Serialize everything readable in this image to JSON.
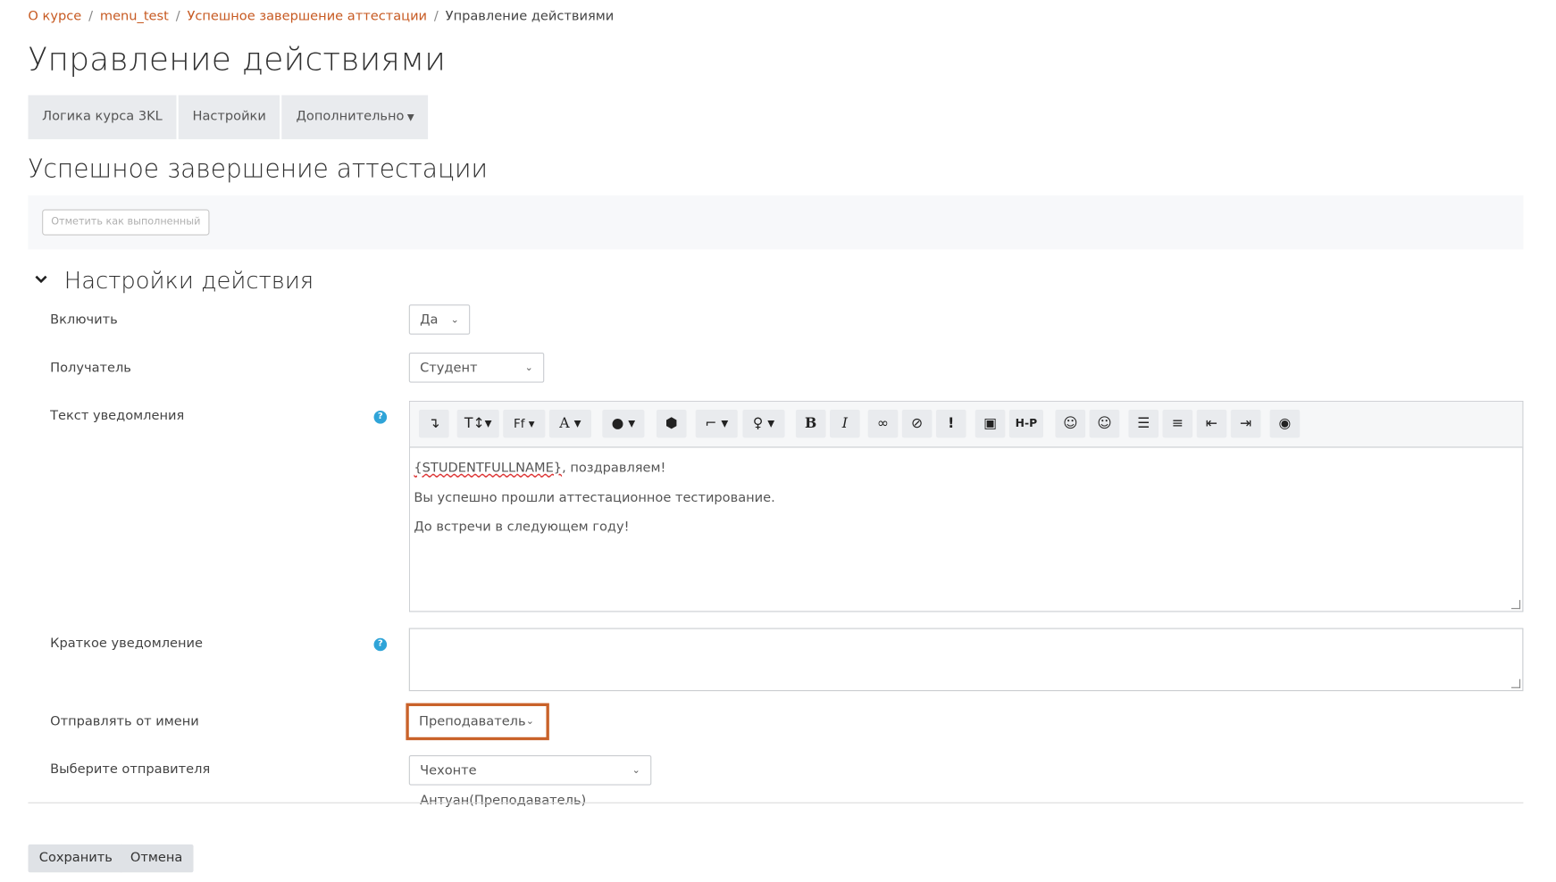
{
  "breadcrumb": {
    "items": [
      "О курсе",
      "menu_test",
      "Успешное завершение аттестации"
    ],
    "current": "Управление действиями",
    "separator": "/"
  },
  "page_title": "Управление действиями",
  "tabs": [
    {
      "label": "Логика курса 3KL"
    },
    {
      "label": "Настройки"
    },
    {
      "label": "Дополнительно"
    }
  ],
  "section_title": "Успешное завершение аттестации",
  "mark_done_label": "Отметить как выполненный",
  "fieldset_title": "Настройки действия",
  "form": {
    "enable": {
      "label": "Включить",
      "value": "Да"
    },
    "recipient": {
      "label": "Получатель",
      "value": "Студент"
    },
    "notification_text": {
      "label": "Текст уведомления",
      "lines": [
        {
          "token": "{STUDENTFULLNAME}",
          "rest": ", поздравляем!"
        },
        {
          "text": "Вы успешно прошли аттестационное тестирование."
        },
        {
          "text": "До встречи в следующем году!"
        }
      ]
    },
    "short_notification": {
      "label": "Краткое уведомление",
      "value": ""
    },
    "send_as": {
      "label": "Отправлять от имени",
      "value": "Преподаватель"
    },
    "sender": {
      "label": "Выберите отправителя",
      "value": "Чехонте Антуан(Преподаватель)"
    }
  },
  "toolbar_icons": [
    "collapse-icon",
    "text-style-icon",
    "font-family-icon",
    "font-size-icon",
    "font-color-icon",
    "background-icon",
    "styles-icon",
    "hint-icon",
    "bold-icon",
    "italic-icon",
    "link-icon",
    "unlink-icon",
    "special-char-icon",
    "image-icon",
    "h5p-icon",
    "emoji-icon",
    "emoji-picker-icon",
    "unordered-list-icon",
    "ordered-list-icon",
    "outdent-icon",
    "indent-icon",
    "accessibility-icon"
  ],
  "buttons": {
    "save": "Сохранить",
    "cancel": "Отмена"
  },
  "colors": {
    "link": "#c75a22",
    "highlight": "#c9622a",
    "help": "#2fa4d8"
  }
}
